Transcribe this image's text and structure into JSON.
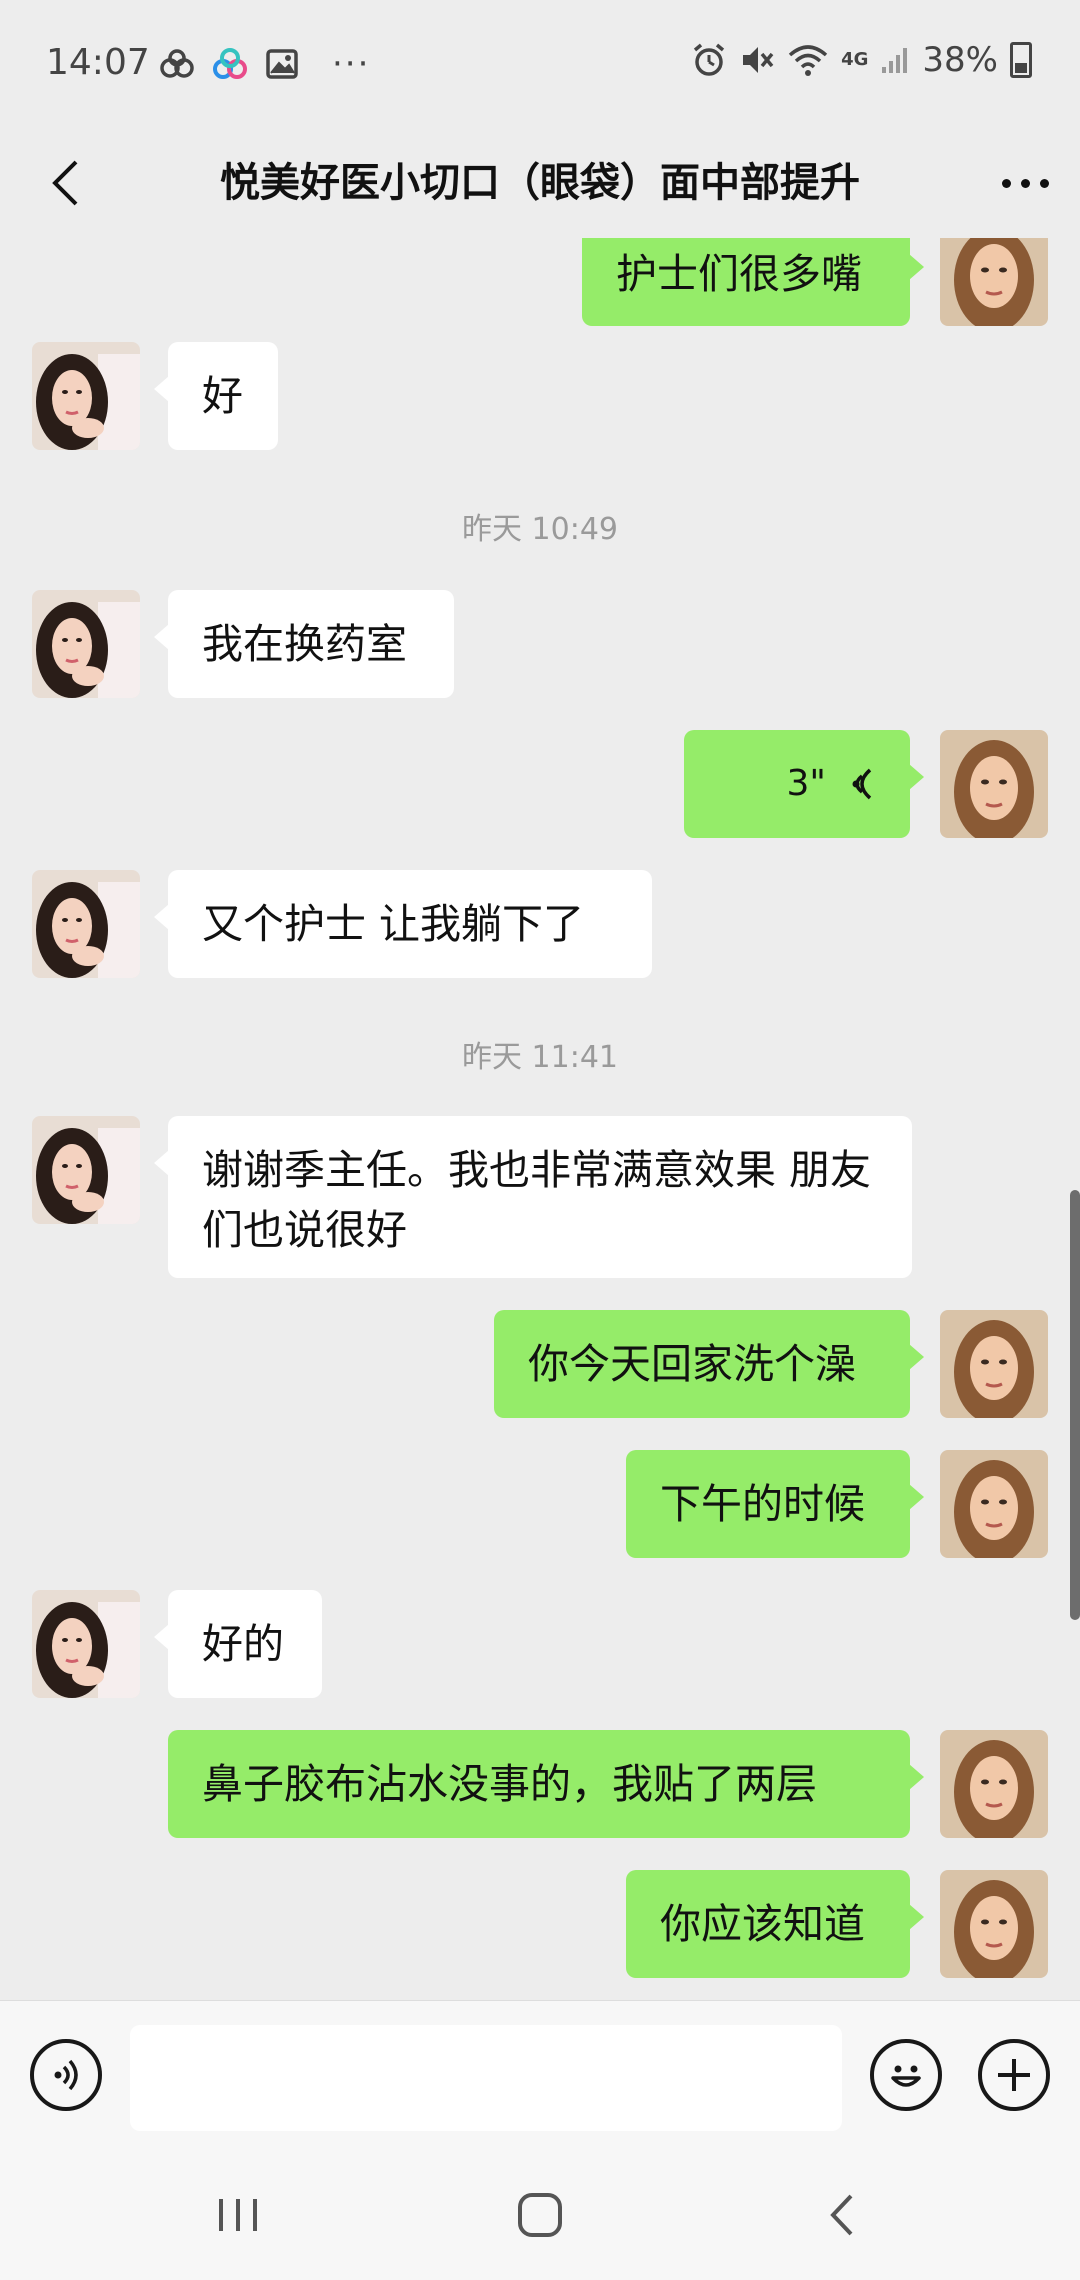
{
  "status_bar": {
    "time": "14:07",
    "more_glyph": "···",
    "network": "4G",
    "battery": "38%",
    "icons": [
      "baidu-cloud-icon",
      "photos-icon",
      "gallery-icon",
      "alarm-icon",
      "mute-icon",
      "wifi-icon",
      "signal-icon",
      "battery-icon"
    ]
  },
  "header": {
    "title": "悦美好医小切口（眼袋）面中部提升"
  },
  "messages": [
    {
      "side": "right",
      "text": "护士们很多嘴"
    },
    {
      "side": "left",
      "text": "好"
    },
    {
      "type": "time",
      "text": "昨天 10:49"
    },
    {
      "side": "left",
      "text": "我在换药室"
    },
    {
      "side": "right",
      "type": "voice",
      "text": "3\""
    },
    {
      "side": "left",
      "text": "又个护士 让我躺下了"
    },
    {
      "type": "time",
      "text": "昨天 11:41"
    },
    {
      "side": "left",
      "text": "谢谢季主任。我也非常满意效果 朋友们也说很好"
    },
    {
      "side": "right",
      "text": "你今天回家洗个澡"
    },
    {
      "side": "right",
      "text": "下午的时候"
    },
    {
      "side": "left",
      "text": "好的"
    },
    {
      "side": "right",
      "text": "鼻子胶布沾水没事的，我贴了两层"
    },
    {
      "side": "right",
      "text": "你应该知道"
    }
  ],
  "input": {
    "value": "",
    "placeholder": ""
  },
  "colors": {
    "background": "#ededed",
    "sent_bubble": "#95ec69",
    "received_bubble": "#ffffff"
  }
}
